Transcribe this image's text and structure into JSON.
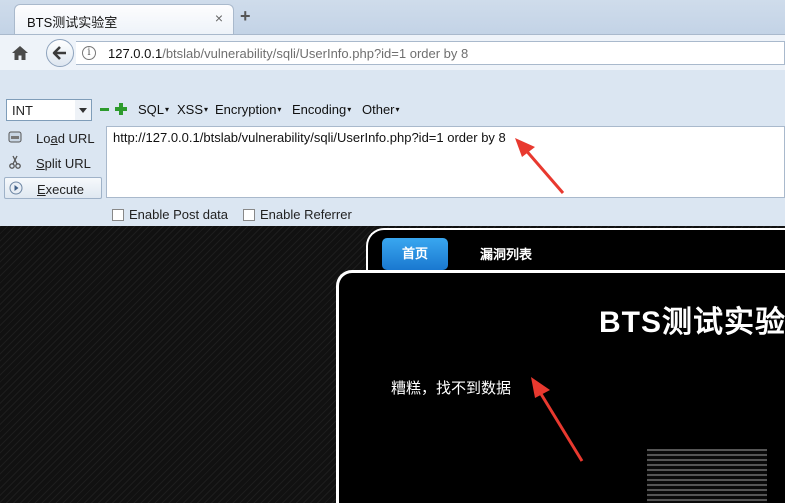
{
  "browser": {
    "tab_title": "BTS测试实验室",
    "tab_close": "×",
    "new_tab": "+",
    "url_host": "127.0.0.1",
    "url_path": "/btslab/vulnerability/sqli/UserInfo.php?id=1 order by 8"
  },
  "hackbar": {
    "type_select": "INT",
    "menus": [
      "SQL",
      "XSS",
      "Encryption",
      "Encoding",
      "Other"
    ],
    "load_url": {
      "pre": "Lo",
      "key": "a",
      "post": "d URL"
    },
    "split_url": {
      "pre": "",
      "key": "S",
      "post": "plit URL"
    },
    "execute": {
      "pre": "",
      "key": "E",
      "post": "xecute"
    },
    "textarea_value": "http://127.0.0.1/btslab/vulnerability/sqli/UserInfo.php?id=1 order by 8",
    "enable_post": "Enable Post data",
    "enable_referrer": "Enable Referrer"
  },
  "site": {
    "nav_home": "首页",
    "nav_vuln_list": "漏洞列表",
    "title": "BTS测试实验",
    "error_message": "糟糕，找不到数据"
  },
  "colors": {
    "annotation": "#e8392f",
    "nav_button": "#2a8ee0",
    "browser_chrome": "#dbe6f2"
  }
}
